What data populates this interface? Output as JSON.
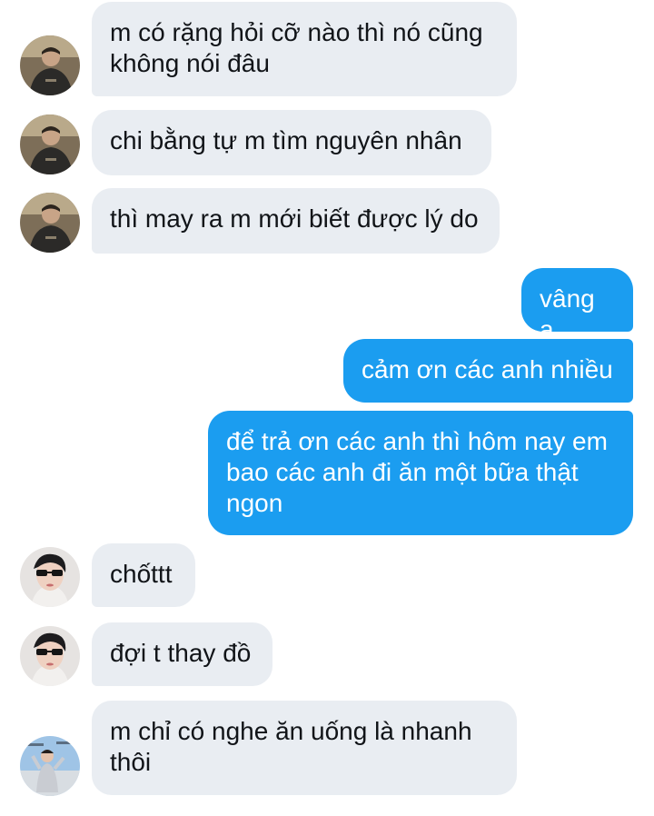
{
  "conversation": {
    "messages": [
      {
        "sender": "other",
        "avatar": "avatar-man-dark-shirt",
        "text": "m có rặng hỏi cỡ nào thì nó cũng không nói đâu"
      },
      {
        "sender": "other",
        "avatar": "avatar-man-dark-shirt",
        "text": "chi bằng tự m tìm nguyên nhân"
      },
      {
        "sender": "other",
        "avatar": "avatar-man-dark-shirt",
        "text": "thì may ra m mới biết được lý do"
      },
      {
        "sender": "self",
        "text": "vâng ạ"
      },
      {
        "sender": "self",
        "text": "cảm ơn các anh nhiều"
      },
      {
        "sender": "self",
        "text": "để trả ơn các anh thì hôm nay em bao các anh đi ăn một bữa thật ngon"
      },
      {
        "sender": "other",
        "avatar": "avatar-man-sunglasses",
        "text": "chốttt"
      },
      {
        "sender": "other",
        "avatar": "avatar-man-sunglasses",
        "text": "đợi t thay đồ"
      },
      {
        "sender": "other",
        "avatar": "avatar-man-outdoor",
        "text": "m chỉ có nghe ăn uống là nhanh thôi"
      }
    ]
  },
  "colors": {
    "incoming_bubble": "#e9edf2",
    "outgoing_bubble": "#1b9df0",
    "background": "#ffffff"
  }
}
